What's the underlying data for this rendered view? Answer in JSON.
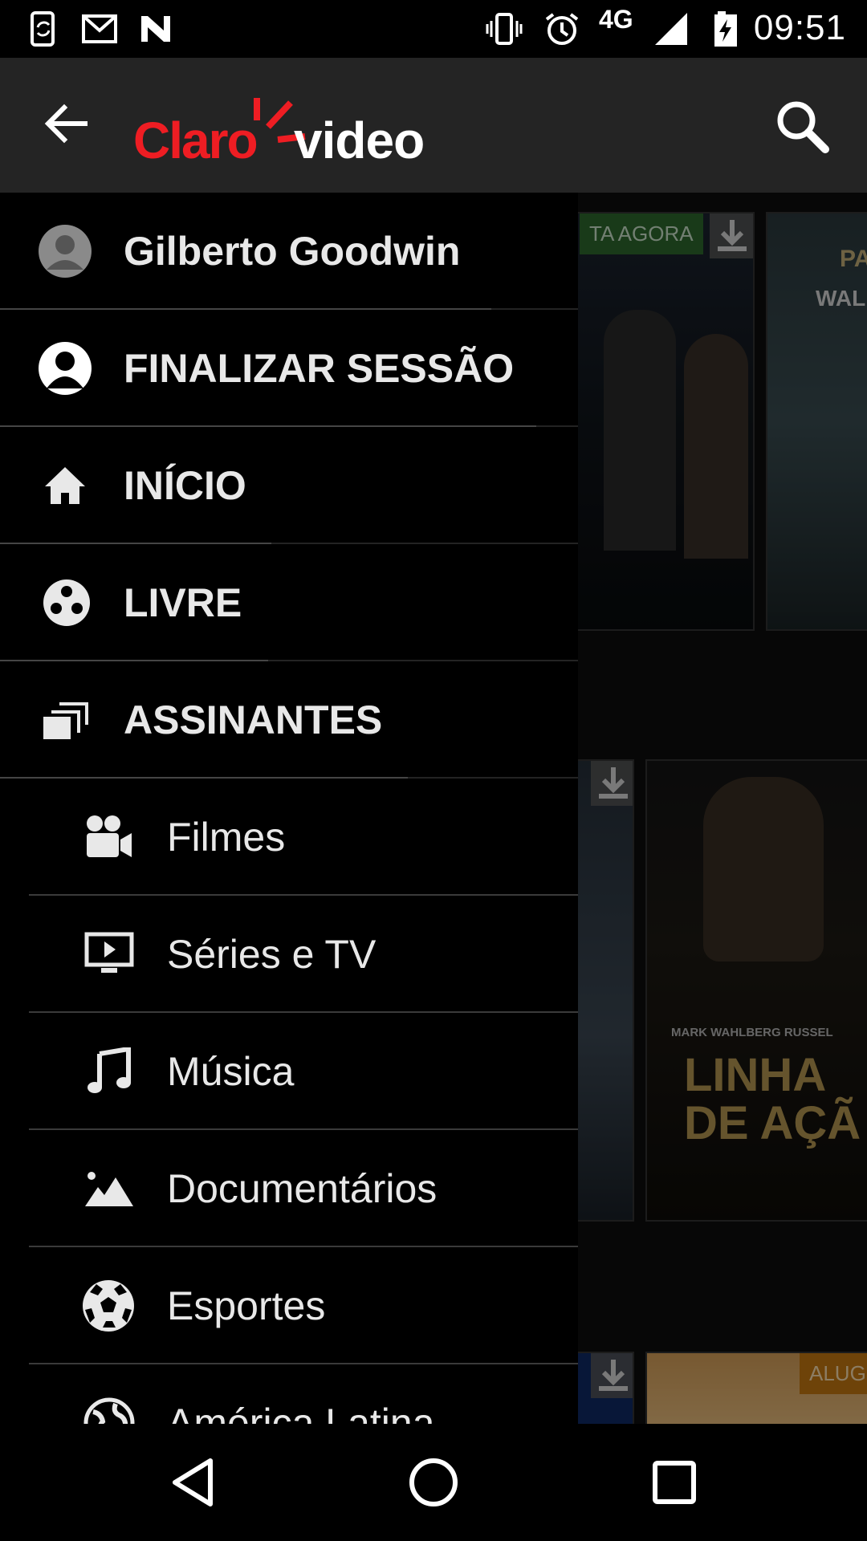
{
  "status_bar": {
    "time": "09:51",
    "network": "4G",
    "icons": [
      "sync-phone-icon",
      "gmail-icon",
      "nfc-icon",
      "vibrate-icon",
      "alarm-icon",
      "signal-icon",
      "battery-charging-icon"
    ]
  },
  "app_bar": {
    "logo_primary": "Claro",
    "logo_secondary": "video",
    "brand_color": "#ee1d23",
    "back_icon": "arrow-back-icon",
    "search_icon": "search-icon"
  },
  "drawer": {
    "user_name": "Gilberto Goodwin",
    "logout_label": "FINALIZAR SESSÃO",
    "items": [
      {
        "label": "INÍCIO",
        "icon": "home-icon"
      },
      {
        "label": "LIVRE",
        "icon": "film-reel-icon"
      },
      {
        "label": "ASSINANTES",
        "icon": "stacked-windows-icon"
      }
    ],
    "sub_items": [
      {
        "label": "Filmes",
        "icon": "movie-camera-icon"
      },
      {
        "label": "Séries e TV",
        "icon": "tv-play-icon"
      },
      {
        "label": "Música",
        "icon": "music-note-icon"
      },
      {
        "label": "Documentários",
        "icon": "landscape-icon"
      },
      {
        "label": "Esportes",
        "icon": "soccer-ball-icon"
      },
      {
        "label": "América Latina",
        "icon": "globe-icon"
      }
    ]
  },
  "background": {
    "badge_watch": "TA AGORA",
    "badge_rent": "ALUG",
    "poster_title": "LINHA\nDE AÇÃ",
    "poster_names": "MARK WAHLBERG     RUSSEL",
    "poster_top_right_1": "PA",
    "poster_top_right_2": "WAL"
  },
  "nav_bar": {
    "back": "nav-back-icon",
    "home": "nav-home-icon",
    "recents": "nav-recents-icon"
  }
}
